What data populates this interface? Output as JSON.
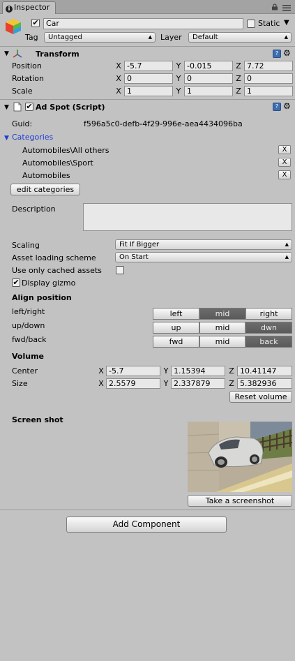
{
  "window": {
    "tab_label": "Inspector",
    "lock_icon": "lock-icon",
    "menu_icon": "menu-icon"
  },
  "gameobject": {
    "active": true,
    "name": "Car",
    "static_label": "Static",
    "static_checked": false,
    "tag_label": "Tag",
    "tag_value": "Untagged",
    "layer_label": "Layer",
    "layer_value": "Default"
  },
  "transform": {
    "title": "Transform",
    "rows": [
      {
        "label": "Position",
        "x": "-5.7",
        "y": "-0.015",
        "z": "7.72"
      },
      {
        "label": "Rotation",
        "x": "0",
        "y": "0",
        "z": "0"
      },
      {
        "label": "Scale",
        "x": "1",
        "y": "1",
        "z": "1"
      }
    ],
    "axes": [
      "X",
      "Y",
      "Z"
    ]
  },
  "adspot": {
    "title": "Ad Spot (Script)",
    "enabled": true,
    "guid_label": "Guid:",
    "guid_value": "f596a5c0-defb-4f29-996e-aea4434096ba",
    "categories_label": "Categories",
    "categories": [
      "Automobiles\\All others",
      "Automobiles\\Sport",
      "Automobiles"
    ],
    "remove_label": "X",
    "edit_categories_label": "edit categories",
    "description_label": "Description",
    "description_value": "",
    "scaling_label": "Scaling",
    "scaling_value": "Fit If Bigger",
    "loading_label": "Asset loading scheme",
    "loading_value": "On Start",
    "cached_label": "Use only cached assets",
    "cached_checked": false,
    "gizmo_label": "Display gizmo",
    "gizmo_checked": true,
    "align_title": "Align position",
    "align_rows": [
      {
        "label": "left/right",
        "options": [
          "left",
          "mid",
          "right"
        ],
        "selected": 1
      },
      {
        "label": "up/down",
        "options": [
          "up",
          "mid",
          "dwn"
        ],
        "selected": 2
      },
      {
        "label": "fwd/back",
        "options": [
          "fwd",
          "mid",
          "back"
        ],
        "selected": 2
      }
    ],
    "volume_title": "Volume",
    "volume_rows": [
      {
        "label": "Center",
        "x": "-5.7",
        "y": "1.15394",
        "z": "10.41147"
      },
      {
        "label": "Size",
        "x": "2.5579",
        "y": "2.337879",
        "z": "5.382936"
      }
    ],
    "reset_volume_label": "Reset volume",
    "screenshot_title": "Screen shot",
    "take_screenshot_label": "Take a screenshot"
  },
  "add_component_label": "Add Component",
  "colors": {
    "link_blue": "#1a3fd6",
    "selected_segment": "#5e5e5e",
    "panel_bg": "#c2c2c2"
  }
}
